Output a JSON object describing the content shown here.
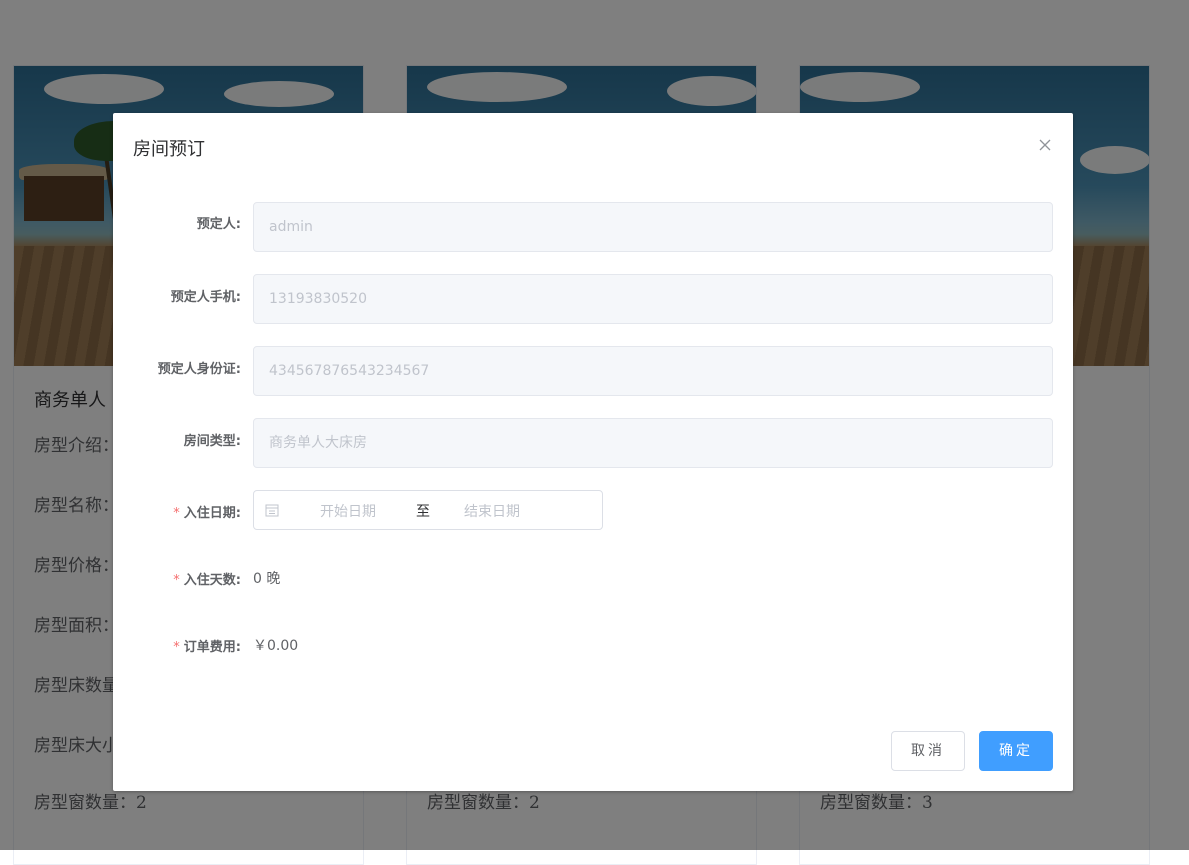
{
  "cards": [
    {
      "title": "商务单人",
      "lines": [
        "房型介绍：",
        "房型名称：",
        "房型价格：",
        "房型面积：",
        "房型床数量",
        "房型床大小",
        "房型窗数量：2"
      ]
    },
    {
      "lines": [
        "房型窗数量：2"
      ]
    },
    {
      "lines": [
        "房型窗数量：3"
      ]
    }
  ],
  "dialog": {
    "title": "房间预订",
    "fields": {
      "booker": {
        "label": "预定人:",
        "value": "admin"
      },
      "phone": {
        "label": "预定人手机:",
        "value": "13193830520"
      },
      "id_card": {
        "label": "预定人身份证:",
        "value": "434567876543234567"
      },
      "room_type": {
        "label": "房间类型:",
        "value": "商务单人大床房"
      },
      "checkin_date": {
        "label": "入住日期:",
        "required": "*",
        "start_placeholder": "开始日期",
        "separator": "至",
        "end_placeholder": "结束日期"
      },
      "nights": {
        "label": "入住天数:",
        "required": "*",
        "value": "0 晚"
      },
      "fee": {
        "label": "订单费用:",
        "required": "*",
        "value": "￥0.00"
      }
    },
    "buttons": {
      "cancel": "取消",
      "confirm": "确定"
    }
  },
  "colors": {
    "primary": "#409eff",
    "required": "#f56c6c",
    "overlay": "rgba(0,0,0,0.5)"
  },
  "icons": {
    "close": "close-icon",
    "calendar": "calendar-icon"
  }
}
